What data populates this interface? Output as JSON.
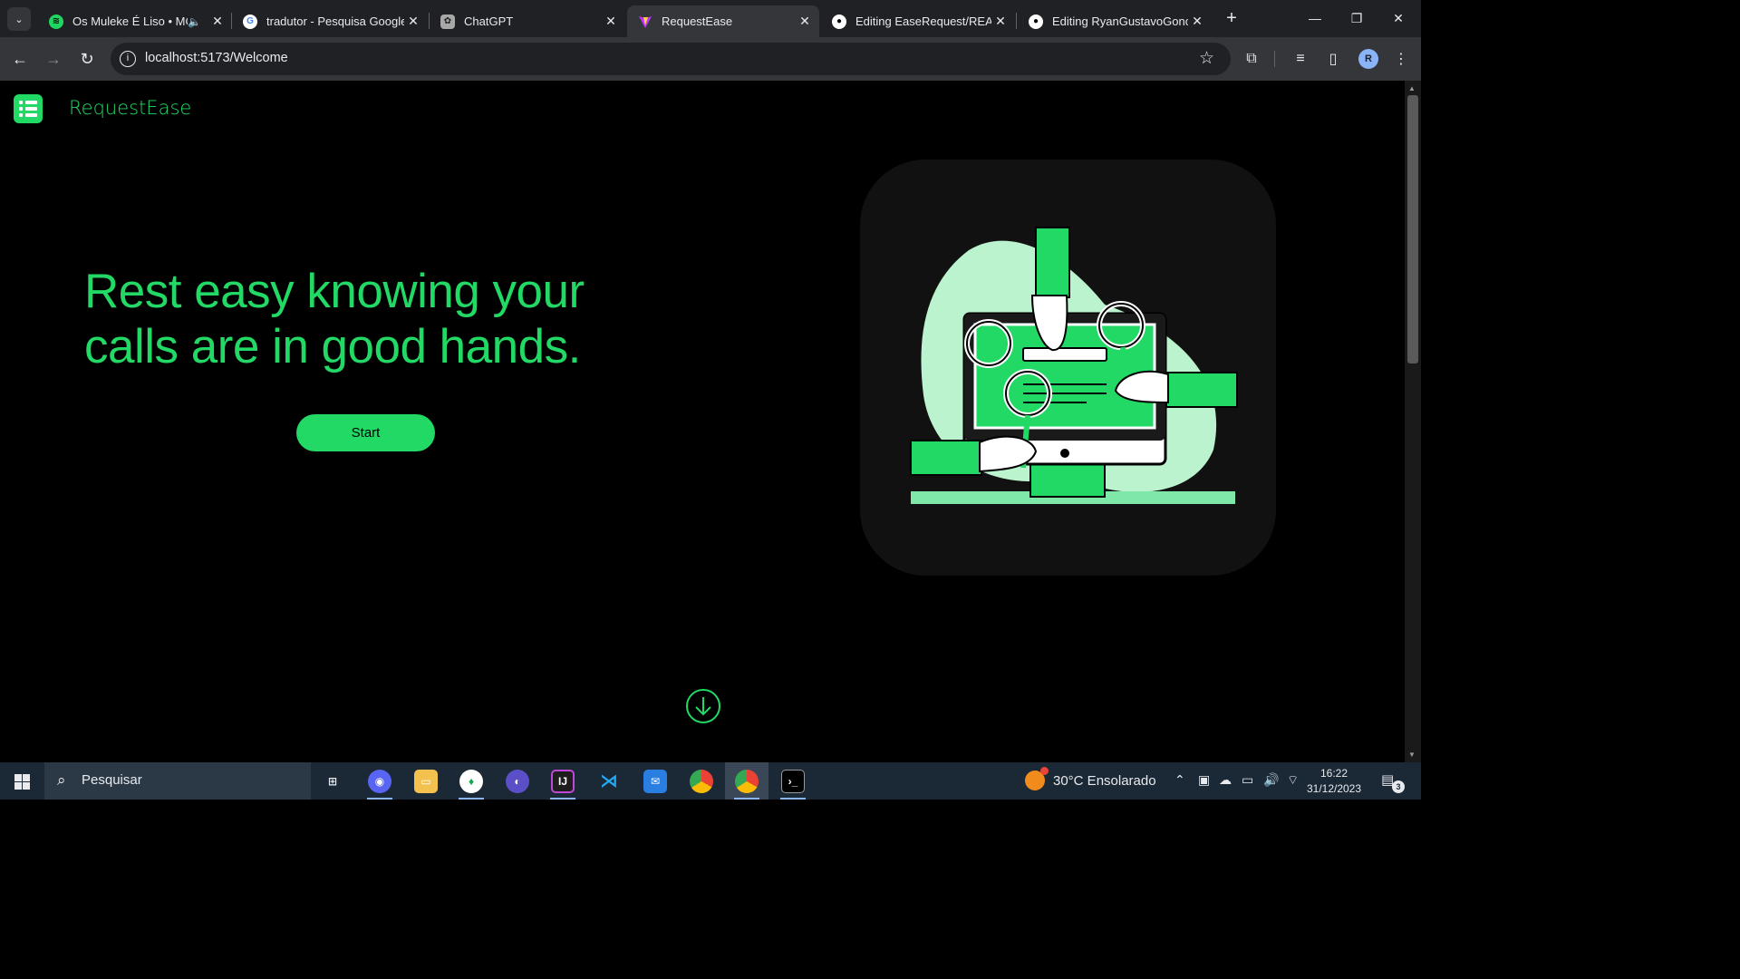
{
  "browser": {
    "tabs": [
      {
        "title": "Os Muleke É Liso • MC",
        "favicon": "spotify-icon",
        "color": "#1ed760",
        "audio": true
      },
      {
        "title": "tradutor - Pesquisa Google",
        "favicon": "google-icon",
        "color": "#ffffff"
      },
      {
        "title": "ChatGPT",
        "favicon": "chatgpt-icon",
        "color": "#a8a8a8"
      },
      {
        "title": "RequestEase",
        "favicon": "vite-icon",
        "color": "#bd34fe",
        "active": true
      },
      {
        "title": "Editing EaseRequest/READ",
        "favicon": "github-icon",
        "color": "#ffffff"
      },
      {
        "title": "Editing RyanGustavoGonc",
        "favicon": "github-icon",
        "color": "#ffffff"
      }
    ],
    "url": "localhost:5173/Welcome",
    "profile_initial": "R"
  },
  "app": {
    "brand": "RequestEase",
    "hero_line1": "Rest easy knowing your",
    "hero_line2": "calls are in good hands.",
    "start_label": "Start",
    "accent": "#22d965",
    "illustration_light": "#baf3cd"
  },
  "taskbar": {
    "search_placeholder": "Pesquisar",
    "weather": "30°C  Ensolarado",
    "time": "16:22",
    "date": "31/12/2023",
    "notifications": "3"
  }
}
